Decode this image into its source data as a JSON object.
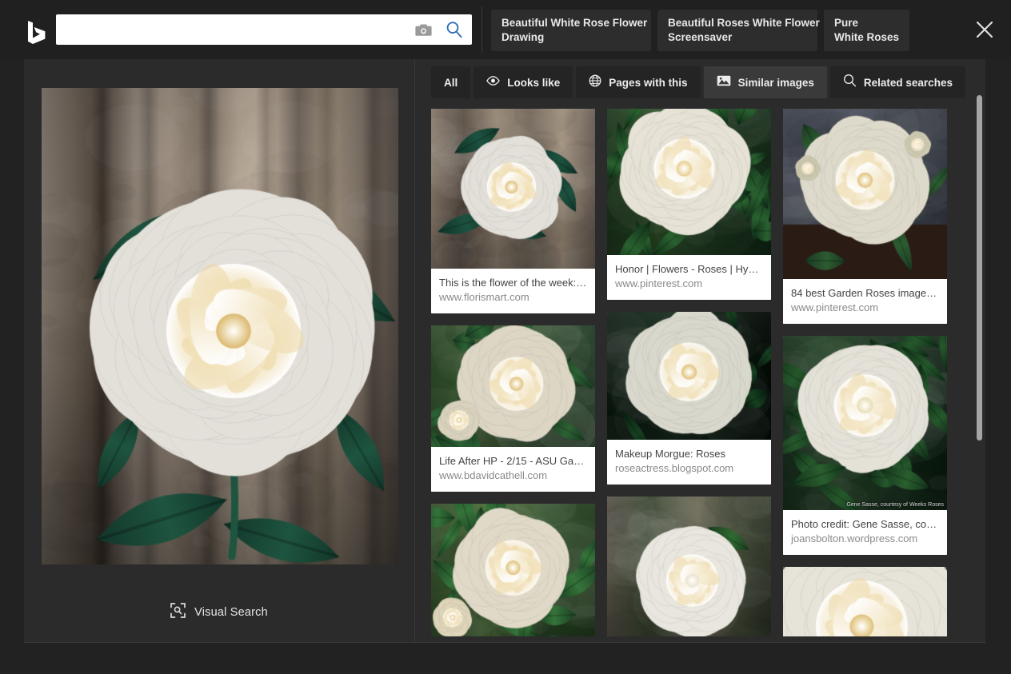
{
  "header": {
    "logo_alt": "Bing",
    "search": {
      "value": "",
      "placeholder": "",
      "camera_icon": "camera-icon",
      "search_icon": "magnifier-icon"
    },
    "close_label": "×",
    "suggestions": [
      {
        "line1": "Beautiful White Rose Flower",
        "line2": "Drawing"
      },
      {
        "line1": "Beautiful Roses White Flower",
        "line2": "Screensaver"
      },
      {
        "line1": "Pure",
        "line2": "White Roses"
      }
    ]
  },
  "left_pane": {
    "visual_search_label": "Visual Search",
    "visual_search_icon": "visual-search-scan-icon",
    "hero_alt": "White rose on blurred wooden background"
  },
  "tabs": [
    {
      "label": "All",
      "icon": "none",
      "active": false
    },
    {
      "label": "Looks like",
      "icon": "eye-icon",
      "active": false
    },
    {
      "label": "Pages with this",
      "icon": "globe-icon",
      "active": false
    },
    {
      "label": "Similar images",
      "icon": "image-icon",
      "active": true
    },
    {
      "label": "Related searches",
      "icon": "magnifier-icon",
      "active": false
    }
  ],
  "results": {
    "columns": [
      [
        {
          "title": "This is the flower of the week: …",
          "url": "www.florismart.com",
          "thumb_height": 200,
          "style": "wood-rose",
          "watermark": ""
        },
        {
          "title": "Life After HP - 2/15 - ASU Ga…",
          "url": "www.bdavidcathell.com",
          "thumb_height": 152,
          "style": "garden-cream-rose",
          "watermark": ""
        },
        {
          "title": "",
          "url": "",
          "thumb_height": 178,
          "style": "cream-rose-bud",
          "watermark": ""
        }
      ],
      [
        {
          "title": "Honor | Flowers - Roses | Hybr…",
          "url": "www.pinterest.com",
          "thumb_height": 193,
          "style": "leafy-white-rose",
          "watermark": ""
        },
        {
          "title": "Makeup Morgue: Roses",
          "url": "roseactress.blogspot.com",
          "thumb_height": 160,
          "style": "dark-bg-rose",
          "watermark": ""
        },
        {
          "title": "",
          "url": "",
          "thumb_height": 175,
          "style": "camellia",
          "watermark": ""
        }
      ],
      [
        {
          "title": "84 best Garden Roses images…",
          "url": "www.pinterest.com",
          "thumb_height": 213,
          "style": "studio-rose",
          "watermark": ""
        },
        {
          "title": "Photo credit: Gene Sasse, cou…",
          "url": "joansbolton.wordpress.com",
          "thumb_height": 218,
          "style": "gene-sasse-rose",
          "watermark": "Gene Sasse, courtesy of Weeks Roses"
        },
        {
          "title": "",
          "url": "",
          "thumb_height": 120,
          "style": "closeup-petals",
          "watermark": ""
        }
      ]
    ]
  },
  "colors": {
    "window_bg": "#222222",
    "pane_bg": "#2b2b2b",
    "header_bg": "#202020",
    "chip_bg": "#2d2d2d",
    "tab_bg": "#242424",
    "tab_active_bg": "#3a3a3a",
    "accent_blue": "#2f6fb5",
    "caption_title": "#444444",
    "caption_url": "#8a8a8a",
    "scrollbar_thumb": "#a6a6a6"
  }
}
